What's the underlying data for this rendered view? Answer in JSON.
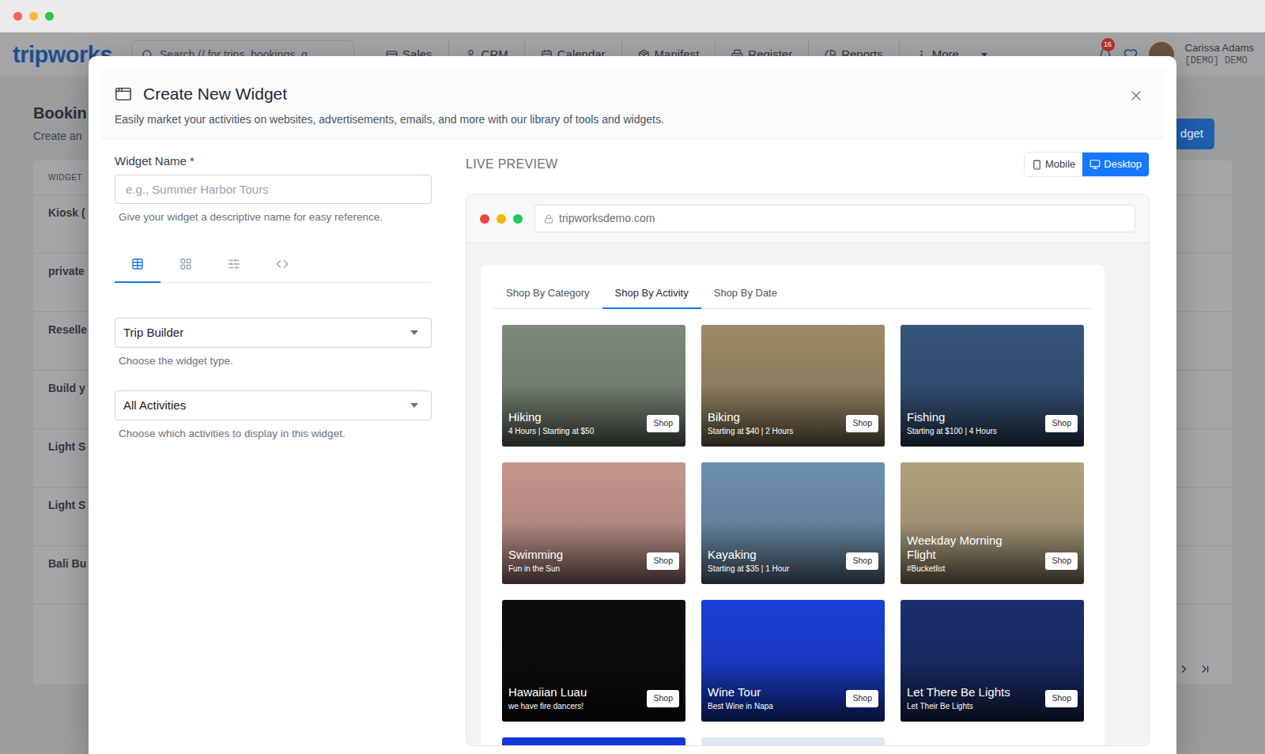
{
  "nav": {
    "logo": "tripworks",
    "search": {
      "placeholder": "Search (/ for trips, bookings, g"
    },
    "items": [
      {
        "label": "Sales",
        "kind": "sales"
      },
      {
        "label": "CRM",
        "kind": "crm"
      },
      {
        "label": "Calendar",
        "kind": "calendar"
      },
      {
        "label": "Manifest",
        "kind": "manifest"
      },
      {
        "label": "Register",
        "kind": "register"
      },
      {
        "label": "Reports",
        "kind": "reports"
      },
      {
        "label": "More",
        "kind": "more"
      }
    ],
    "notifications": "16",
    "user": {
      "name": "Carissa Adams",
      "org": "[DEMO] DEMO"
    }
  },
  "page": {
    "title": "Bookin",
    "subtitle": "Create an",
    "button": "dget",
    "table": {
      "columns": [
        "WIDGET"
      ],
      "rows": [
        "Kiosk (",
        "private",
        "Reselle",
        "Build y",
        "Light S",
        "Light S",
        "Bali Bu"
      ]
    }
  },
  "modal": {
    "title": "Create New Widget",
    "subtitle": "Easily market your activities on websites, advertisements, emails, and more with our library of tools and widgets.",
    "form": {
      "name": {
        "label": "Widget Name *",
        "placeholder": "e.g., Summer Harbor Tours",
        "help": "Give your widget a descriptive name for easy reference."
      },
      "tabs": [
        {
          "kind": "table",
          "selected": true
        },
        {
          "kind": "grid",
          "selected": false
        },
        {
          "kind": "settings",
          "selected": false
        },
        {
          "kind": "code",
          "selected": false
        }
      ],
      "selects": [
        {
          "value": "Trip Builder",
          "help": "Choose the widget type."
        },
        {
          "value": "All Activities",
          "help": "Choose which activities to display in this widget."
        }
      ]
    },
    "preview": {
      "label": "LIVE PREVIEW",
      "devices": [
        {
          "label": "Mobile",
          "kind": "mobile",
          "selected": false
        },
        {
          "label": "Desktop",
          "kind": "desktop",
          "selected": true
        }
      ],
      "browser": {
        "url": "tripworksdemo.com"
      },
      "tabs": [
        {
          "label": "Shop By Category",
          "selected": false
        },
        {
          "label": "Shop By Activity",
          "selected": true
        },
        {
          "label": "Shop By Date",
          "selected": false
        }
      ],
      "cards": [
        {
          "title": "Hiking",
          "subtitle": "4 Hours | Starting at $50",
          "action": "Shop",
          "color": "#7d8a7a"
        },
        {
          "title": "Biking",
          "subtitle": "Starting at $40 | 2 Hours",
          "action": "Shop",
          "color": "#9c8a68"
        },
        {
          "title": "Fishing",
          "subtitle": "Starting at $100 | 4 Hours",
          "action": "Shop",
          "color": "#35557a"
        },
        {
          "title": "Swimming",
          "subtitle": "Fun in the Sun",
          "action": "Shop",
          "color": "#c4968e"
        },
        {
          "title": "Kayaking",
          "subtitle": "Starting at $35 | 1 Hour",
          "action": "Shop",
          "color": "#6d8fae"
        },
        {
          "title": "Weekday Morning Flight",
          "subtitle": "#Bucketlist",
          "action": "Shop",
          "color": "#b0a07e"
        },
        {
          "title": "Hawaiian Luau",
          "subtitle": "we have fire dancers!",
          "action": "Shop",
          "color": "#0d0d0d"
        },
        {
          "title": "Wine Tour",
          "subtitle": "Best Wine in Napa",
          "action": "Shop",
          "color": "#1a3fd6"
        },
        {
          "title": "Let There Be Lights",
          "subtitle": "Let Their Be Lights",
          "action": "Shop",
          "color": "#1b2d6b"
        },
        {
          "color": "#1238d8"
        },
        {
          "color": "#dfe8f1"
        }
      ]
    }
  }
}
